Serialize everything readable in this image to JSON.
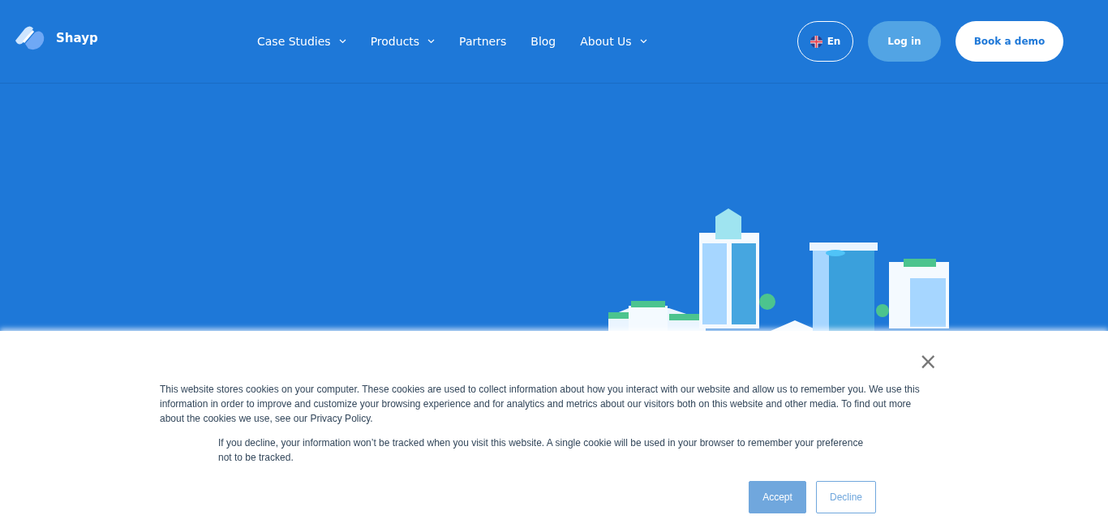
{
  "header": {
    "brand": "Shayp",
    "nav": [
      {
        "label": "Case Studies",
        "has_dropdown": true
      },
      {
        "label": "Products",
        "has_dropdown": true
      },
      {
        "label": "Partners",
        "has_dropdown": false
      },
      {
        "label": "Blog",
        "has_dropdown": false
      },
      {
        "label": "About Us",
        "has_dropdown": true
      }
    ],
    "language": "En",
    "login": "Log in",
    "demo": "Book a demo"
  },
  "cookie_banner": {
    "close": "×",
    "text": "This website stores cookies on your computer. These cookies are used to collect information about how you interact with our website and allow us to remember you. We use this information in order to improve and customize your browsing experience and for analytics and metrics about our visitors both on this website and other media. To find out more about the cookies we use, see our Privacy Policy.",
    "decline_note": "If you decline, your information won’t be tracked when you visit this website. A single cookie will be used in your browser to remember your preference not to be tracked.",
    "accept": "Accept",
    "decline": "Decline"
  }
}
